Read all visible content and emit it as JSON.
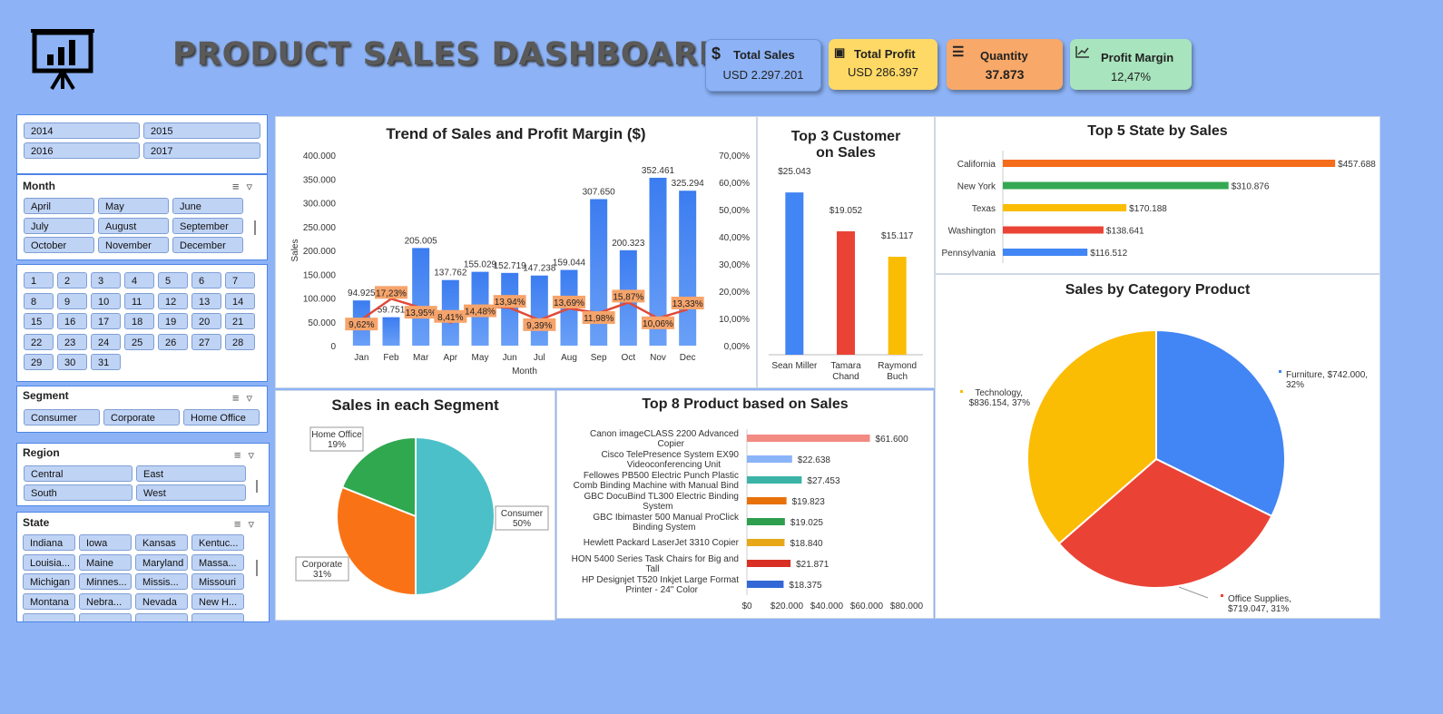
{
  "header": {
    "title": "PRODUCT SALES DASHBOARD",
    "kpis": [
      {
        "label": "Total Sales",
        "value": "USD 2.297.201",
        "icon": "dollar-icon",
        "color": "#8db3f6"
      },
      {
        "label": "Total Profit",
        "value": "USD 286.397",
        "icon": "money-bag-icon",
        "color": "#ffd966"
      },
      {
        "label": "Quantity",
        "value": "37.873",
        "icon": "stack-icon",
        "color": "#f8a868"
      },
      {
        "label": "Profit Margin",
        "value": "12,47%",
        "icon": "trend-chart-icon",
        "color": "#a8e4bd"
      }
    ]
  },
  "slicers": {
    "years": [
      "2014",
      "2015",
      "2016",
      "2017"
    ],
    "month": {
      "label": "Month",
      "items": [
        "April",
        "May",
        "June",
        "July",
        "August",
        "September",
        "October",
        "November",
        "December"
      ]
    },
    "days": [
      "1",
      "2",
      "3",
      "4",
      "5",
      "6",
      "7",
      "8",
      "9",
      "10",
      "11",
      "12",
      "13",
      "14",
      "15",
      "16",
      "17",
      "18",
      "19",
      "20",
      "21",
      "22",
      "23",
      "24",
      "25",
      "26",
      "27",
      "28",
      "29",
      "30",
      "31"
    ],
    "segment": {
      "label": "Segment",
      "items": [
        "Consumer",
        "Corporate",
        "Home Office"
      ]
    },
    "region": {
      "label": "Region",
      "items": [
        "Central",
        "East",
        "South",
        "West"
      ]
    },
    "state": {
      "label": "State",
      "items": [
        "Indiana",
        "Iowa",
        "Kansas",
        "Kentuc...",
        "Louisia...",
        "Maine",
        "Maryland",
        "Massa...",
        "Michigan",
        "Minnes...",
        "Missis...",
        "Missouri",
        "Montana",
        "Nebra...",
        "Nevada",
        "New H..."
      ]
    }
  },
  "colors": {
    "bar_blue": "#4285f4",
    "red": "#ea4335",
    "yellow": "#fbbc04",
    "green": "#34a853",
    "orange": "#f46d1a"
  },
  "chart_data": [
    {
      "type": "bar",
      "title": "Trend of Sales and Profit Margin ($)",
      "xlabel": "Month",
      "ylabel": "Sales",
      "categories": [
        "Jan",
        "Feb",
        "Mar",
        "Apr",
        "May",
        "Jun",
        "Jul",
        "Aug",
        "Sep",
        "Oct",
        "Nov",
        "Dec"
      ],
      "series": [
        {
          "values": [
            94925,
            59751,
            205005,
            137762,
            155029,
            152719,
            147238,
            159044,
            307650,
            200323,
            352461,
            325294
          ]
        },
        {
          "type": "line",
          "axis": "secondary",
          "values": [
            9.62,
            17.23,
            13.95,
            8.41,
            14.48,
            13.94,
            9.39,
            13.69,
            11.98,
            15.87,
            10.06,
            13.33
          ]
        }
      ],
      "bar_labels": [
        "94.925",
        "59.751",
        "205.005",
        "137.762",
        "155.029",
        "152.719",
        "147.238",
        "159.044",
        "307.650",
        "200.323",
        "352.461",
        "325.294"
      ],
      "line_labels": [
        "9,62%",
        "17,23%",
        "13,95%",
        "8,41%",
        "14,48%",
        "13,94%",
        "9,39%",
        "13,69%",
        "11,98%",
        "15,87%",
        "10,06%",
        "13,33%"
      ],
      "y_ticks": [
        "0",
        "50.000",
        "100.000",
        "150.000",
        "200.000",
        "250.000",
        "300.000",
        "350.000",
        "400.000"
      ],
      "y2_ticks": [
        "0,00%",
        "10,00%",
        "20,00%",
        "30,00%",
        "40,00%",
        "50,00%",
        "60,00%",
        "70,00%"
      ],
      "ylim": [
        0,
        400000
      ],
      "y2lim": [
        0,
        70
      ]
    },
    {
      "type": "bar",
      "title": "Top 3 Customer on Sales",
      "categories": [
        "Sean Miller",
        "Tamara Chand",
        "Raymond Buch"
      ],
      "values": [
        25043,
        19052,
        15117
      ],
      "labels": [
        "$25.043",
        "$19.052",
        "$15.117"
      ],
      "colors": [
        "#4285f4",
        "#ea4335",
        "#fbbc04"
      ],
      "ylim": [
        0,
        28000
      ]
    },
    {
      "type": "bar",
      "orientation": "horizontal",
      "title": "Top 5 State by Sales",
      "categories": [
        "California",
        "New York",
        "Texas",
        "Washington",
        "Pennsylvania"
      ],
      "values": [
        457688,
        310876,
        170188,
        138641,
        116512
      ],
      "labels": [
        "$457.688",
        "$310.876",
        "$170.188",
        "$138.641",
        "$116.512"
      ],
      "colors": [
        "#f46d1a",
        "#34a853",
        "#fbbc04",
        "#ea4335",
        "#4285f4"
      ],
      "xlim": [
        0,
        460000
      ]
    },
    {
      "type": "pie",
      "title": "Sales in each Segment",
      "categories": [
        "Consumer",
        "Corporate",
        "Home Office"
      ],
      "values": [
        50,
        31,
        19
      ],
      "labels": [
        "50%",
        "31%",
        "19%"
      ],
      "colors": [
        "#4bc0c8",
        "#f97316",
        "#2fa84f"
      ]
    },
    {
      "type": "bar",
      "orientation": "horizontal",
      "title": "Top 8 Product based on Sales",
      "categories": [
        "Canon imageCLASS 2200 Advanced Copier",
        "Cisco TelePresence System EX90 Videoconferencing Unit",
        "Fellowes PB500 Electric Punch Plastic Comb Binding Machine with Manual Bind",
        "GBC DocuBind TL300 Electric Binding System",
        "GBC Ibimaster 500 Manual ProClick Binding System",
        "Hewlett Packard LaserJet 3310 Copier",
        "HON 5400 Series Task Chairs for Big and Tall",
        "HP Designjet T520 Inkjet Large Format Printer - 24\" Color"
      ],
      "category_lines": [
        [
          "Canon imageCLASS 2200 Advanced",
          "Copier"
        ],
        [
          "Cisco TelePresence System EX90",
          "Videoconferencing Unit"
        ],
        [
          "Fellowes PB500 Electric Punch Plastic",
          "Comb Binding Machine with Manual Bind"
        ],
        [
          "GBC DocuBind TL300 Electric Binding",
          "System"
        ],
        [
          "GBC Ibimaster 500 Manual ProClick",
          "Binding System"
        ],
        [
          "Hewlett Packard LaserJet 3310 Copier"
        ],
        [
          "HON 5400 Series Task Chairs for Big and",
          "Tall"
        ],
        [
          "HP Designjet T520 Inkjet Large Format",
          "Printer - 24\" Color"
        ]
      ],
      "values": [
        61600,
        22638,
        27453,
        19823,
        19025,
        18840,
        21871,
        18375
      ],
      "labels": [
        "$61.600",
        "$22.638",
        "$27.453",
        "$19.823",
        "$19.025",
        "$18.840",
        "$21.871",
        "$18.375"
      ],
      "colors": [
        "#f28b82",
        "#8ab4f8",
        "#3bb3a6",
        "#e8710a",
        "#2e9e4f",
        "#e6a817",
        "#d93025",
        "#3367d6"
      ],
      "x_ticks": [
        "$0",
        "$20.000",
        "$40.000",
        "$60.000",
        "$80.000"
      ],
      "xlim": [
        0,
        80000
      ]
    },
    {
      "type": "pie",
      "title": "Sales by Category Product",
      "categories": [
        "Furniture",
        "Office Supplies",
        "Technology"
      ],
      "values": [
        742000,
        719047,
        836154
      ],
      "labels": [
        "Furniture, $742.000, 32%",
        "Office Supplies, $719.047, 31%",
        "Technology, $836.154, 37%"
      ],
      "label_lines": [
        [
          "Furniture, $742.000,",
          "32%"
        ],
        [
          "Office Supplies,",
          "$719.047, 31%"
        ],
        [
          "Technology,",
          "$836.154, 37%"
        ]
      ],
      "colors": [
        "#4285f4",
        "#ea4335",
        "#fbbc04"
      ]
    }
  ]
}
